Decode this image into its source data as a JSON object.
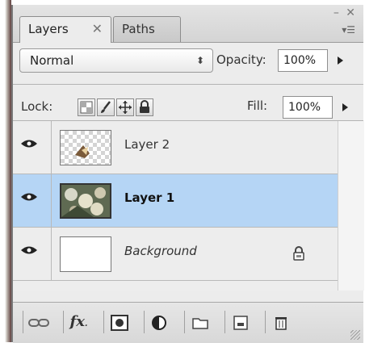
{
  "tabs": [
    {
      "label": "Layers",
      "close": "✕"
    },
    {
      "label": "Paths"
    }
  ],
  "window_controls": "– ✕",
  "blend_mode": {
    "value": "Normal",
    "arrows": "⬍"
  },
  "opacity": {
    "label": "Opacity:",
    "value": "100%"
  },
  "lock": {
    "label": "Lock:",
    "icons": [
      "transparency-lock-icon",
      "brush-lock-icon",
      "move-lock-icon",
      "padlock-icon"
    ]
  },
  "fill": {
    "label": "Fill:",
    "value": "100%"
  },
  "layers": [
    {
      "name": "Layer 2",
      "visible": true,
      "selected": false,
      "thumb": "transparent-with-object"
    },
    {
      "name": "Layer 1",
      "visible": true,
      "selected": true,
      "thumb": "photo"
    },
    {
      "name": "Background",
      "visible": true,
      "selected": false,
      "locked": true,
      "thumb": "white"
    }
  ],
  "toolbar": [
    "link-icon",
    "fx-icon",
    "mask-icon",
    "adjustment-icon",
    "folder-icon",
    "new-layer-icon",
    "trash-icon"
  ],
  "toolbar_fx_label": "fx",
  "colors": {
    "selection": "#b5d5f5",
    "panel": "#ececec"
  }
}
